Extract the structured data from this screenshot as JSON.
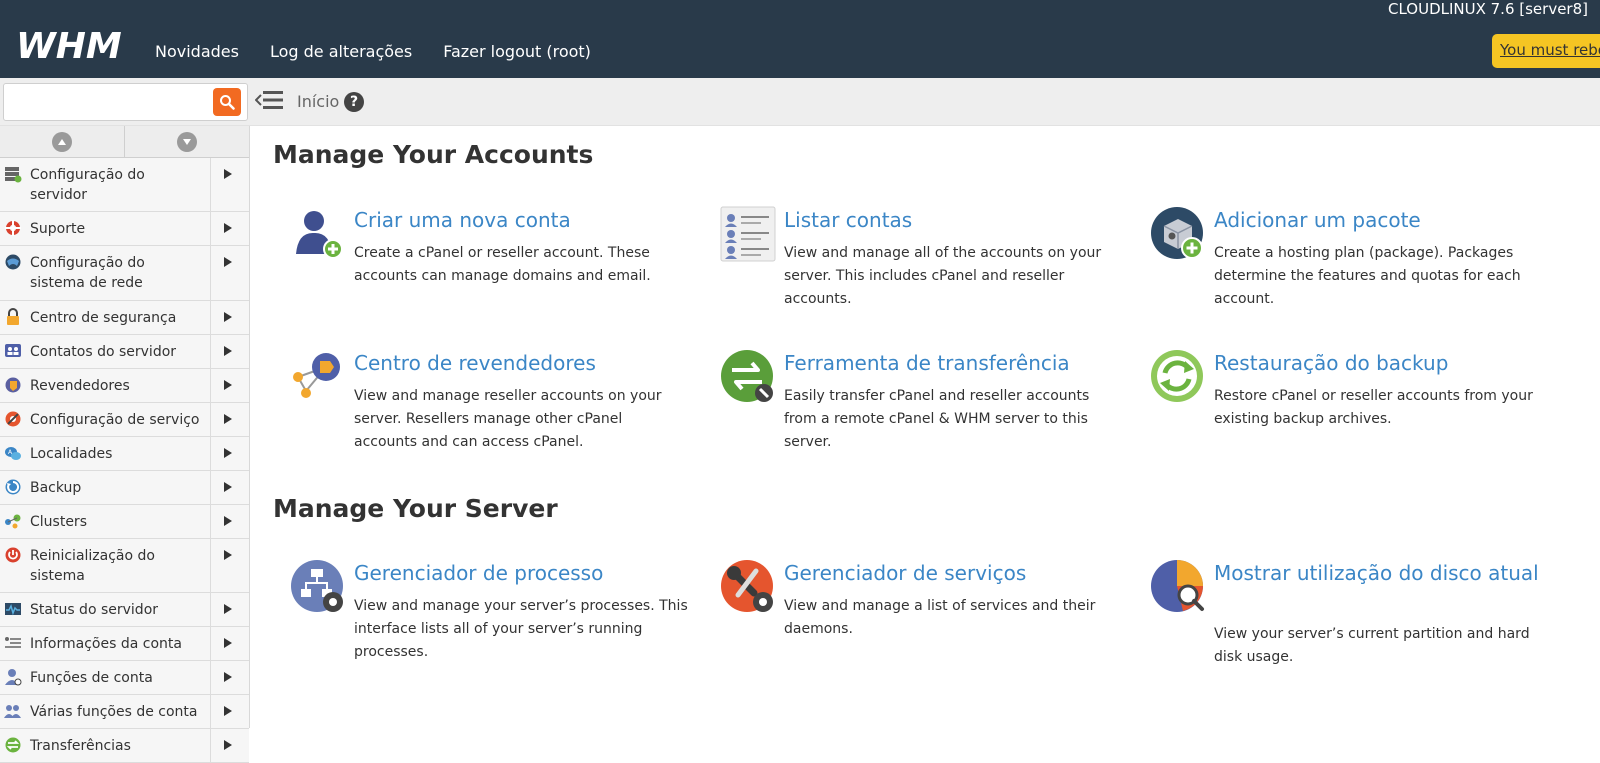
{
  "topbar": {
    "logo_text": "WHM",
    "nav": [
      "Novidades",
      "Log de alterações",
      "Fazer logout (root)"
    ],
    "server_name": "CLOUDLINUX 7.6 [server8]",
    "reboot_notice": "You must reboot"
  },
  "subbar": {
    "search_placeholder": "",
    "breadcrumb": "Início"
  },
  "sidebar": {
    "items": [
      {
        "label": "Configuração do servidor",
        "icon": "server-config-icon"
      },
      {
        "label": "Suporte",
        "icon": "lifebuoy-icon"
      },
      {
        "label": "Configuração do sistema de rede",
        "icon": "network-icon"
      },
      {
        "label": "Centro de segurança",
        "icon": "lock-icon"
      },
      {
        "label": "Contatos do servidor",
        "icon": "contacts-icon"
      },
      {
        "label": "Revendedores",
        "icon": "resellers-icon"
      },
      {
        "label": "Configuração de serviço",
        "icon": "service-config-icon"
      },
      {
        "label": "Localidades",
        "icon": "locales-icon"
      },
      {
        "label": "Backup",
        "icon": "backup-icon"
      },
      {
        "label": "Clusters",
        "icon": "clusters-icon"
      },
      {
        "label": "Reinicialização do sistema",
        "icon": "power-icon"
      },
      {
        "label": "Status do servidor",
        "icon": "status-icon"
      },
      {
        "label": "Informações da conta",
        "icon": "account-info-icon"
      },
      {
        "label": "Funções de conta",
        "icon": "account-functions-icon"
      },
      {
        "label": "Várias funções de conta",
        "icon": "multi-account-icon"
      },
      {
        "label": "Transferências",
        "icon": "transfers-icon"
      }
    ]
  },
  "sections": [
    {
      "title": "Manage Your Accounts",
      "cards": [
        {
          "title": "Criar uma nova conta",
          "desc": "Create a cPanel or reseller account. These accounts can manage domains and email.",
          "icon": "user-add-icon"
        },
        {
          "title": "Listar contas",
          "desc": "View and manage all of the accounts on your server. This includes cPanel and reseller accounts.",
          "icon": "list-accounts-icon"
        },
        {
          "title": "Adicionar um pacote",
          "desc": "Create a hosting plan (package). Packages determine the features and quotas for each account.",
          "icon": "package-add-icon"
        },
        {
          "title": "Centro de revendedores",
          "desc": "View and manage reseller accounts on your server. Resellers manage other cPanel accounts and can access cPanel.",
          "icon": "reseller-center-icon"
        },
        {
          "title": "Ferramenta de transferência",
          "desc": "Easily transfer cPanel and reseller accounts from a remote cPanel & WHM server to this server.",
          "icon": "transfer-tool-icon"
        },
        {
          "title": "Restauração do backup",
          "desc": "Restore cPanel or reseller accounts from your existing backup archives.",
          "icon": "backup-restore-icon"
        }
      ]
    },
    {
      "title": "Manage Your Server",
      "cards": [
        {
          "title": "Gerenciador de processo",
          "desc": "View and manage your server’s processes. This interface lists all of your server’s running processes.",
          "icon": "process-manager-icon"
        },
        {
          "title": "Gerenciador de serviços",
          "desc": "View and manage a list of services and their daemons.",
          "icon": "service-manager-icon"
        },
        {
          "title": "Mostrar utilização do disco atual",
          "desc": "View your server’s current partition and hard disk usage.",
          "icon": "disk-usage-icon"
        }
      ]
    }
  ],
  "colors": {
    "topbar": "#293a4a",
    "accent_orange": "#f26a21",
    "link_blue": "#3b86c6",
    "reboot_yellow": "#f5c523"
  }
}
